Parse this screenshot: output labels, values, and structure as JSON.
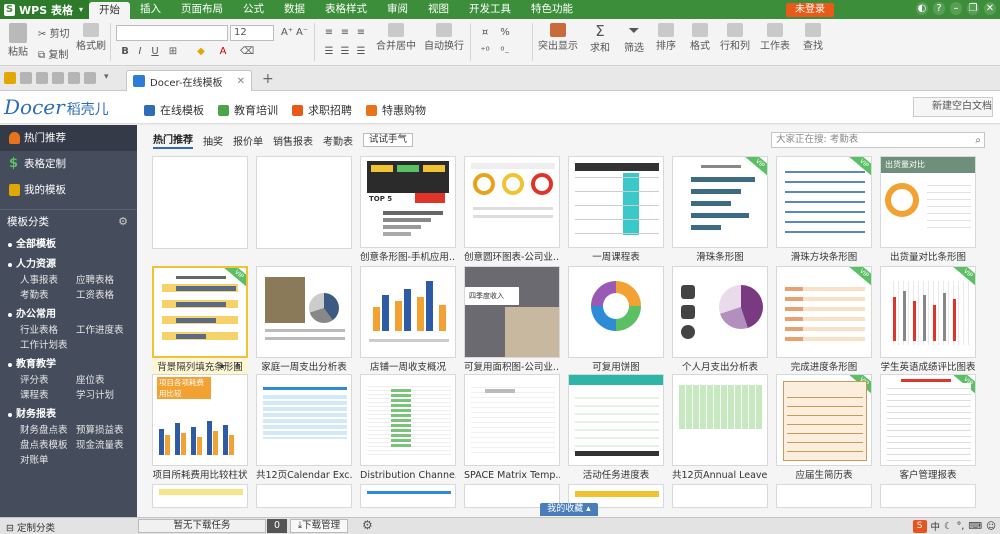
{
  "menubar": {
    "app": "WPS 表格",
    "tabs": [
      "开始",
      "插入",
      "页面布局",
      "公式",
      "数据",
      "表格样式",
      "审阅",
      "视图",
      "开发工具",
      "特色功能"
    ],
    "login": "未登录"
  },
  "ribbon": {
    "paste": "粘贴",
    "cut": "剪切",
    "copy": "复制",
    "format_painter": "格式刷",
    "font_size": "12",
    "merge": "合并居中",
    "wrap": "自动换行",
    "percent": "%",
    "highlight": "突出显示",
    "sum": "求和",
    "filter": "筛选",
    "sort": "排序",
    "format": "格式",
    "rowcol": "行和列",
    "sheet": "工作表",
    "find": "查找"
  },
  "tabbar": {
    "doc_tab": "Docer-在线模板"
  },
  "docer": {
    "logo": "Docer",
    "logo_cn": "稻壳儿",
    "tabs": [
      "在线模板",
      "教育培训",
      "求职招聘",
      "特惠购物"
    ],
    "new_blank": "新建空白文档"
  },
  "sidebar": {
    "hot": "热门推荐",
    "custom": "表格定制",
    "mine": "我的模板",
    "cat_title": "模板分类",
    "all": "全部模板",
    "groups": [
      {
        "title": "人力资源",
        "items": [
          "人事报表",
          "应聘表格",
          "考勤表",
          "工资表格"
        ]
      },
      {
        "title": "办公常用",
        "items": [
          "行业表格",
          "工作进度表",
          "工作计划表"
        ]
      },
      {
        "title": "教育教学",
        "items": [
          "评分表",
          "座位表",
          "课程表",
          "学习计划"
        ]
      },
      {
        "title": "财务报表",
        "items": [
          "财务盘点表",
          "预算损益表",
          "盘点表模板",
          "现金流量表",
          "对账单"
        ]
      }
    ]
  },
  "filters": [
    "热门推荐",
    "抽奖",
    "报价单",
    "销售报表",
    "考勤表"
  ],
  "try_button": "试试手气",
  "search_placeholder": "大家正在搜: 考勤表",
  "cards_row1": [
    "",
    "",
    "创意条形图-手机应用...",
    "创意圆环图表-公司业...",
    "一周课程表",
    "滑珠条形图",
    "滑珠方块条形图",
    "出货量对比条形图"
  ],
  "cards_row2": [
    "背景隔列填充条形图",
    "家庭一周支出分析表",
    "店铺一周收支概况",
    "可复用面积图-公司业...",
    "可复用饼图",
    "个人月支出分析表",
    "完成进度条形图",
    "学生英语成绩评比图表"
  ],
  "cards_row3": [
    "项目所耗费用比较柱状",
    "共12页Calendar Exc...",
    "Distribution Channe...",
    "SPACE Matrix Temp...",
    "活动任务进度表",
    "共12页Annual Leave...",
    "应届生简历表",
    "客户管理报表"
  ],
  "thumb_texts": {
    "r1c3": "TOP 5",
    "r1c7": "出货量对比",
    "r3c1": "项目各项耗费用比较",
    "r2c4": "四季度收入"
  },
  "statusbar": {
    "custom": "定制分类",
    "dl_task": "暂无下载任务",
    "dl_count": "0",
    "dl_manage": "下载管理",
    "favorites": "我的收藏",
    "ime": "中"
  }
}
